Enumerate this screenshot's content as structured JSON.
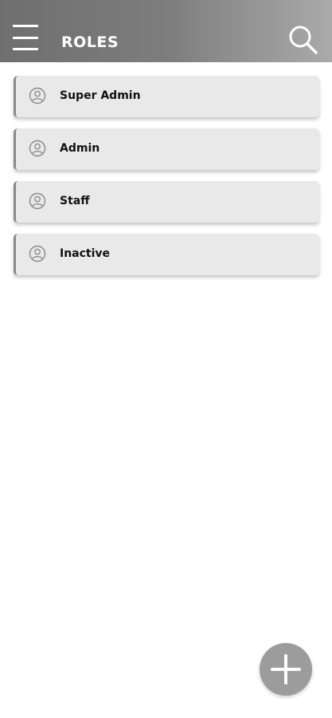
{
  "header": {
    "title": "ROLES",
    "menu_icon": "hamburger-menu-icon",
    "search_icon": "search-icon"
  },
  "roles": [
    {
      "label": "Super Admin",
      "icon": "user-circle-icon"
    },
    {
      "label": "Admin",
      "icon": "user-circle-icon"
    },
    {
      "label": "Staff",
      "icon": "user-circle-icon"
    },
    {
      "label": "Inactive",
      "icon": "user-circle-icon"
    }
  ],
  "fab": {
    "icon": "plus-icon"
  },
  "colors": {
    "header": "#7a7a7a",
    "card_background": "#e9e9e9",
    "fab": "#9c9c9c"
  }
}
